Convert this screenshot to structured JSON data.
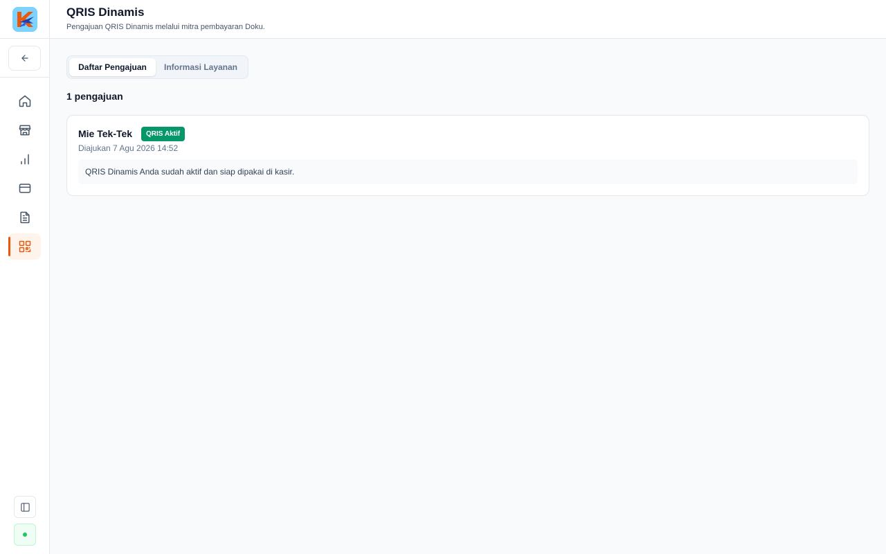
{
  "header": {
    "title": "QRIS Dinamis",
    "subtitle": "Pengajuan QRIS Dinamis melalui mitra pembayaran Doku."
  },
  "sidebar": {
    "logo_icon": "k-logo-icon",
    "back_icon": "arrow-left-icon",
    "items": [
      {
        "icon": "home-icon",
        "active": false
      },
      {
        "icon": "store-icon",
        "active": false
      },
      {
        "icon": "bar-chart-icon",
        "active": false
      },
      {
        "icon": "credit-card-icon",
        "active": false
      },
      {
        "icon": "document-icon",
        "active": false
      },
      {
        "icon": "qr-code-icon",
        "active": true
      }
    ],
    "collapse_icon": "sidebar-panel-icon",
    "status_icon": "online-dot-icon"
  },
  "tabs": [
    {
      "label": "Daftar Pengajuan",
      "active": true
    },
    {
      "label": "Informasi Layanan",
      "active": false
    }
  ],
  "list": {
    "count_label": "1 pengajuan",
    "items": [
      {
        "name": "Mie Tek-Tek",
        "status": "QRIS Aktif",
        "submitted": "Diajukan 7 Agu 2026 14:52",
        "message": "QRIS Dinamis Anda sudah aktif dan siap dipakai di kasir."
      }
    ]
  },
  "colors": {
    "accent": "#ea580c",
    "status_active": "#059669",
    "icon": "#475569"
  }
}
